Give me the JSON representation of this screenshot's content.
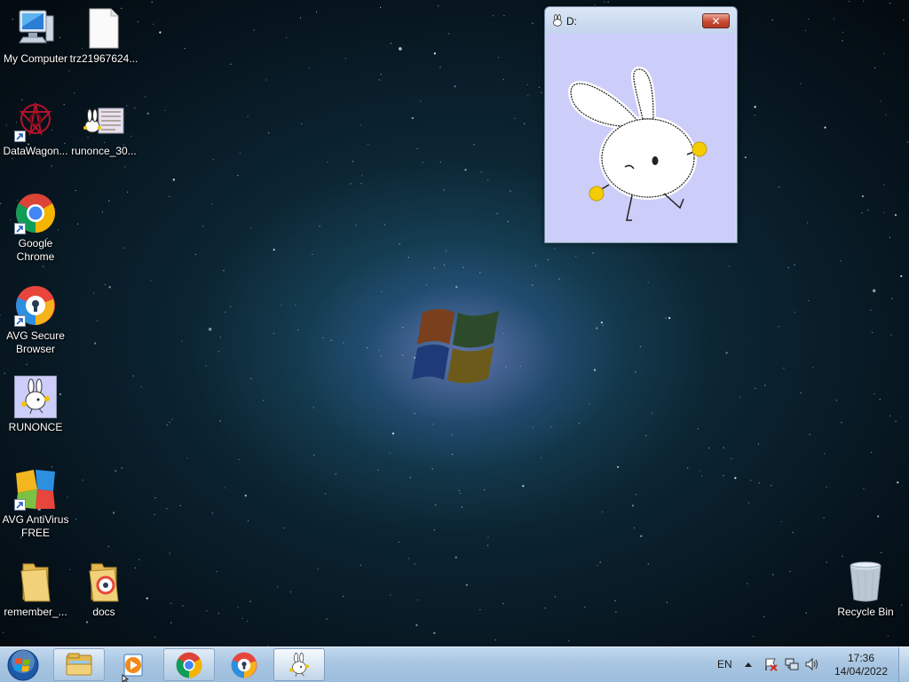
{
  "desktop": {
    "icons": [
      {
        "label": "My Computer",
        "icon": "computer-icon"
      },
      {
        "label": "trz21967624...",
        "icon": "blank-file-icon"
      },
      {
        "label": "DataWagon...",
        "icon": "datawagon-icon"
      },
      {
        "label": "runonce_30...",
        "icon": "bunny-image-icon"
      },
      {
        "label": "Google Chrome",
        "icon": "chrome-icon"
      },
      {
        "label": "AVG Secure Browser",
        "icon": "avg-browser-icon"
      },
      {
        "label": "RUNONCE",
        "icon": "bunny-app-icon"
      },
      {
        "label": "AVG AntiVirus FREE",
        "icon": "avg-antivirus-icon"
      },
      {
        "label": "remember_...",
        "icon": "folder-icon"
      },
      {
        "label": "docs",
        "icon": "folder-icon"
      },
      {
        "label": "Recycle Bin",
        "icon": "recycle-bin-icon"
      }
    ]
  },
  "window": {
    "title": "D:",
    "close_label": "✕"
  },
  "taskbar": {
    "start_icon": "windows-orb-icon",
    "buttons": [
      {
        "name": "explorer",
        "icon": "folder-icon"
      },
      {
        "name": "media-player",
        "icon": "media-player-icon"
      },
      {
        "name": "chrome",
        "icon": "chrome-icon"
      },
      {
        "name": "avg-browser",
        "icon": "avg-browser-icon"
      },
      {
        "name": "runonce",
        "icon": "bunny-app-icon"
      }
    ],
    "language": "EN",
    "tray_icons": [
      "show-hidden-icons-arrow",
      "action-center-flag-icon",
      "network-icon",
      "volume-icon"
    ],
    "clock": {
      "time": "17:36",
      "date": "14/04/2022"
    }
  },
  "colors": {
    "window_client": "#cccdf8",
    "taskbar": "#a9c6e2",
    "close_button": "#c84a33"
  }
}
